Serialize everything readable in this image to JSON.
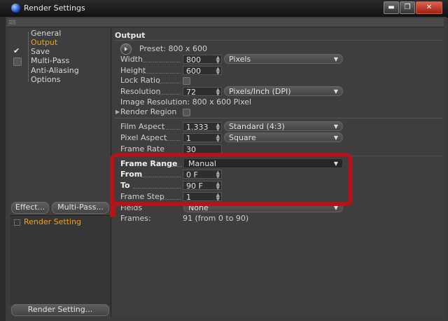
{
  "window": {
    "title": "Render Settings",
    "buttons": [
      "▬",
      "❐",
      "✕"
    ]
  },
  "sidebar": {
    "items": [
      {
        "label": "General",
        "checked": null
      },
      {
        "label": "Output",
        "checked": null,
        "active": true
      },
      {
        "label": "Save",
        "checked": true
      },
      {
        "label": "Multi-Pass",
        "checked": false
      },
      {
        "label": "Anti-Aliasing",
        "checked": null
      },
      {
        "label": "Options",
        "checked": null
      }
    ],
    "effect_button": "Effect...",
    "multipass_button": "Multi-Pass...",
    "render_setting_item": "Render Setting",
    "render_setting_button": "Render Setting..."
  },
  "output": {
    "header": "Output",
    "preset": "Preset: 800 x 600",
    "width_label": "Width",
    "width_value": "800",
    "width_unit": "Pixels",
    "height_label": "Height",
    "height_value": "600",
    "lock_ratio_label": "Lock Ratio",
    "resolution_label": "Resolution",
    "resolution_value": "72",
    "resolution_unit": "Pixels/Inch (DPI)",
    "image_resolution": "Image Resolution: 800 x 600 Pixel",
    "render_region_label": "Render Region",
    "film_aspect_label": "Film Aspect",
    "film_aspect_value": "1.333",
    "film_aspect_option": "Standard (4:3)",
    "pixel_aspect_label": "Pixel Aspect",
    "pixel_aspect_value": "1",
    "pixel_aspect_option": "Square",
    "frame_rate_label": "Frame Rate",
    "frame_rate_value": "30",
    "frame_range_label": "Frame Range",
    "frame_range_option": "Manual",
    "from_label": "From",
    "from_value": "0 F",
    "to_label": "To",
    "to_value": "90 F",
    "frame_step_label": "Frame Step",
    "frame_step_value": "1",
    "fields_label": "Fields",
    "fields_option": "None",
    "frames_label": "Frames:",
    "frames_value": "91 (from 0 to 90)"
  },
  "colors": {
    "accent": "#f0a020",
    "highlight": "#b0151a"
  }
}
